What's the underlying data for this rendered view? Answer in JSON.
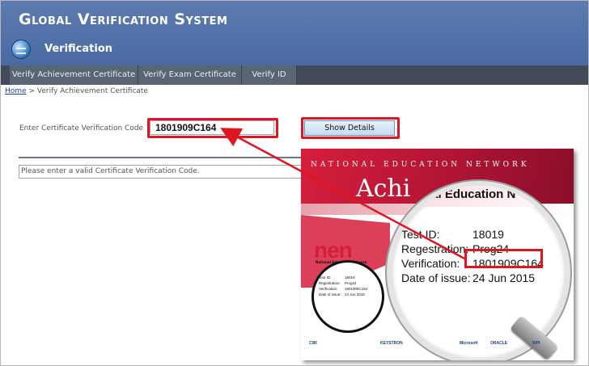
{
  "app": {
    "title": "Global Verification System",
    "page_heading": "Verification"
  },
  "tabs": [
    {
      "label": "Verify Achievement Certificate"
    },
    {
      "label": "Verify Exam Certificate"
    },
    {
      "label": "Verify ID"
    }
  ],
  "breadcrumb": {
    "home": "Home",
    "separator": ">",
    "current": "Verify Achievement Certificate"
  },
  "form": {
    "code_label": "Enter Certificate Verification Code",
    "code_value": "1801909C164",
    "submit_label": "Show Details",
    "message": "Please enter a valid Certificate Verification Code."
  },
  "colors": {
    "header": "#4a6aa3",
    "tabbar": "#424b57",
    "highlight": "#e0151f"
  },
  "certificate": {
    "network": "NATIONAL EDUCATION NETWORK",
    "title": "Achi",
    "logo": "nen",
    "logo_subtitle": "National Education Network",
    "small_fields": [
      {
        "key": "Test ID:",
        "value": "18019"
      },
      {
        "key": "Regestration:",
        "value": "Prog24"
      },
      {
        "key": "Verification:",
        "value": "1801909C164"
      },
      {
        "key": "Date of issue:",
        "value": "24 Jun 2015"
      }
    ],
    "magnified_title": "nal Education N",
    "magnified_fields": [
      {
        "key": "Test ID:",
        "value": "18019"
      },
      {
        "key": "Regestration:",
        "value": "Prog24"
      },
      {
        "key": "Verification:",
        "value": "1801909C164"
      },
      {
        "key": "Date of issue:",
        "value": "24 Jun 2015"
      }
    ],
    "logos": [
      "CWI",
      "KEYSTRON",
      "Microsoft",
      "ORACLE",
      "WPI"
    ]
  }
}
